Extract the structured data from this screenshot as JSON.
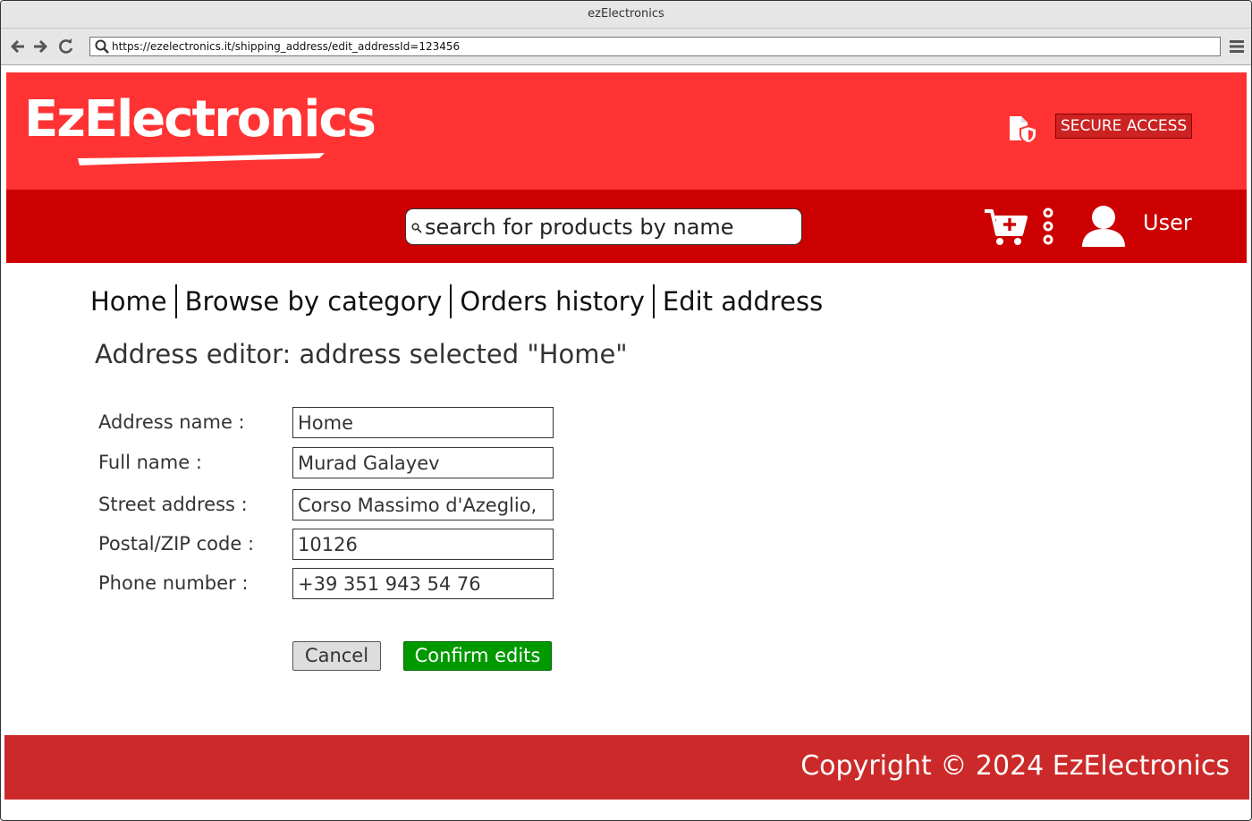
{
  "window": {
    "title": "ezElectronics"
  },
  "browser": {
    "url": "https://ezelectronics.it/shipping_address/edit_addressId=123456"
  },
  "header": {
    "logo_text": "EzElectronics",
    "secure_access_label": "SECURE ACCESS",
    "search_placeholder": "search for products by name",
    "user_label": "User",
    "colors": {
      "brand_bar": "#ff3333",
      "nav_bar": "#cc0000"
    }
  },
  "breadcrumb": {
    "items": [
      "Home",
      "Browse by category",
      "Orders history",
      "Edit address"
    ]
  },
  "page": {
    "title": "Address editor: address selected \"Home\""
  },
  "form": {
    "fields": [
      {
        "label": "Address name :",
        "value": "Home"
      },
      {
        "label": "Full name :",
        "value": "Murad Galayev"
      },
      {
        "label": "Street address :",
        "value": "Corso Massimo d'Azeglio,"
      },
      {
        "label": "Postal/ZIP code :",
        "value": "10126"
      },
      {
        "label": "Phone number :",
        "value": "+39 351 943 54 76"
      }
    ],
    "cancel_label": "Cancel",
    "confirm_label": "Confirm edits",
    "colors": {
      "confirm": "#009900",
      "cancel": "#dddddd"
    }
  },
  "footer": {
    "text": "Copyright © 2024 EzElectronics",
    "color": "#cc2a2a"
  },
  "icons": [
    "back-arrow-icon",
    "forward-arrow-icon",
    "reload-icon",
    "search-icon",
    "hamburger-menu-icon",
    "secure-document-shield-icon",
    "add-to-cart-icon",
    "kebab-menu-icon",
    "user-avatar-icon"
  ]
}
